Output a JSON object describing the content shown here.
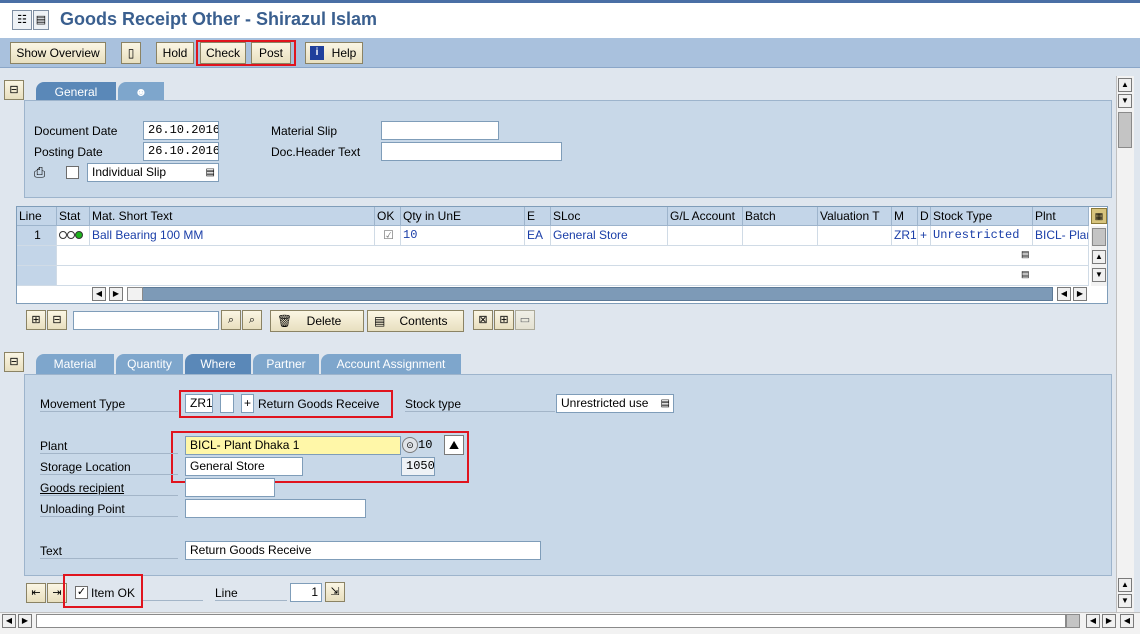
{
  "window": {
    "title": "Goods Receipt Other - Shirazul Islam"
  },
  "toolbar": {
    "show_overview": "Show Overview",
    "hold": "Hold",
    "check": "Check",
    "post": "Post",
    "help": "Help"
  },
  "header_tabs": {
    "general": "General"
  },
  "general": {
    "document_date_label": "Document Date",
    "document_date": "26.10.2016",
    "posting_date_label": "Posting Date",
    "posting_date": "26.10.2016",
    "material_slip_label": "Material Slip",
    "material_slip": "",
    "doc_header_text_label": "Doc.Header Text",
    "doc_header_text": "",
    "slip_type": "Individual Slip"
  },
  "items_table": {
    "columns": [
      "Line",
      "Stat",
      "Mat. Short Text",
      "OK",
      "Qty in UnE",
      "E",
      "SLoc",
      "G/L Account",
      "Batch",
      "Valuation T",
      "M",
      "D",
      "Stock Type",
      "Plnt"
    ],
    "rows": [
      {
        "line": "1",
        "mat_short_text": "Ball Bearing 100 MM",
        "qty": "10",
        "unit": "EA",
        "sloc": "General Store",
        "movement": "ZR1",
        "debit": "+",
        "stock_type": "Unrestricted",
        "plant": "BICL- Plant"
      }
    ]
  },
  "item_toolbar": {
    "delete": "Delete",
    "contents": "Contents"
  },
  "detail_tabs": {
    "material": "Material",
    "quantity": "Quantity",
    "where": "Where",
    "partner": "Partner",
    "account_assignment": "Account Assignment"
  },
  "where": {
    "movement_type_label": "Movement Type",
    "movement_type": "ZR1",
    "movement_indicator": "+",
    "movement_text": "Return Goods Receive",
    "stock_type_label": "Stock type",
    "stock_type": "Unrestricted use",
    "plant_label": "Plant",
    "plant": "BICL- Plant Dhaka 1",
    "plant_code": "10",
    "storage_location_label": "Storage Location",
    "storage_location": "General Store",
    "storage_location_code": "1050",
    "goods_recipient_label": "Goods recipient",
    "goods_recipient": "",
    "unloading_point_label": "Unloading Point",
    "unloading_point": "",
    "text_label": "Text",
    "text": "Return Goods Receive"
  },
  "footer": {
    "item_ok_label": "Item OK",
    "line_label": "Line",
    "line": "1"
  }
}
